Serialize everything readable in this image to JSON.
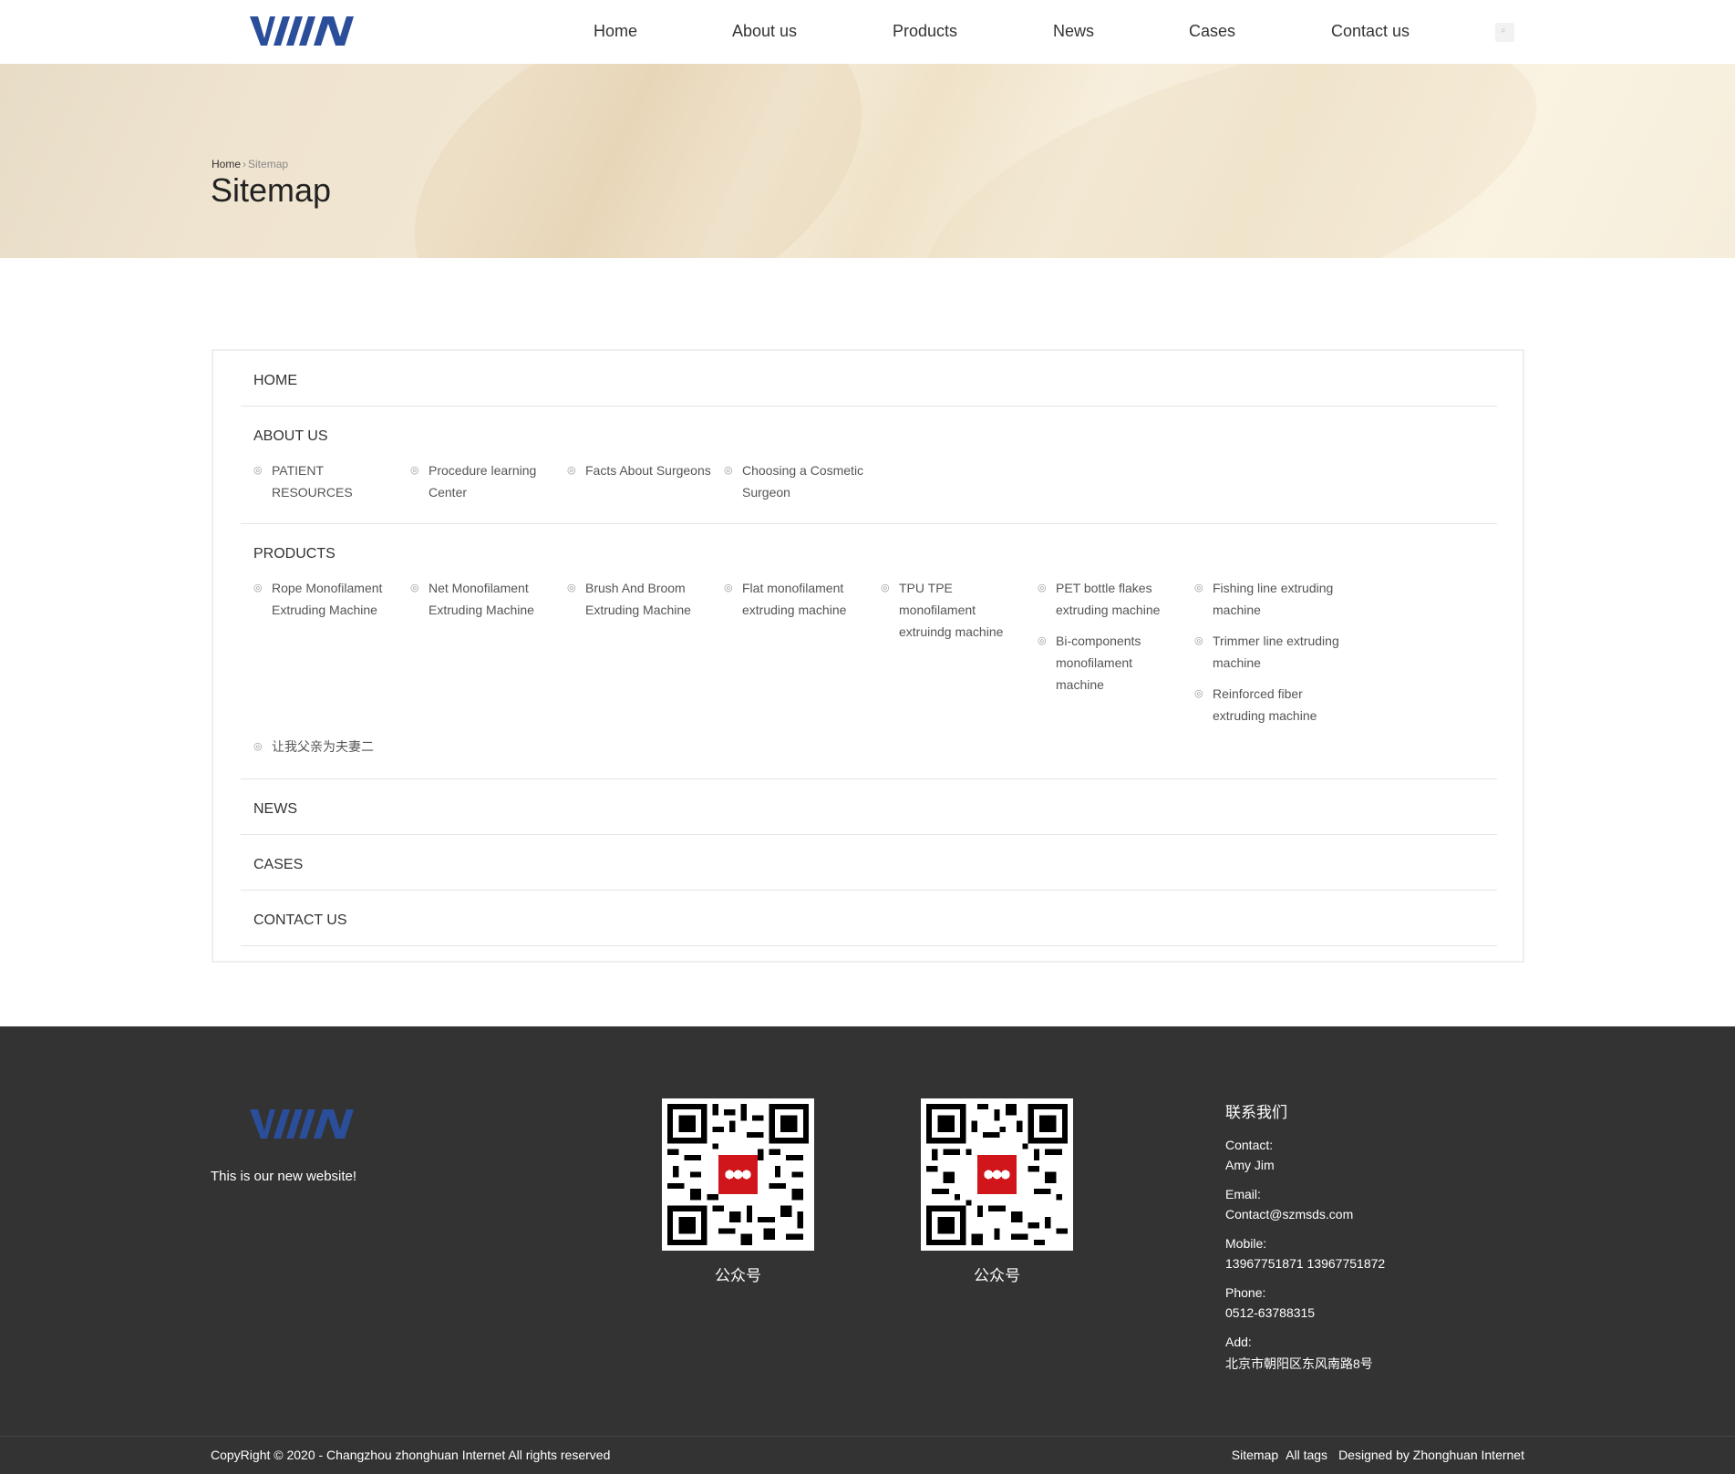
{
  "brand": {
    "logo_text": "VWMA",
    "logo_color": "#2b4e9b"
  },
  "nav": {
    "items": [
      {
        "label": "Home"
      },
      {
        "label": "About us"
      },
      {
        "label": "Products"
      },
      {
        "label": "News"
      },
      {
        "label": "Cases"
      },
      {
        "label": "Contact us"
      }
    ],
    "search_icon": "search-icon"
  },
  "banner": {
    "breadcrumb": {
      "home": "Home",
      "separator": "›",
      "current": "Sitemap"
    },
    "title": "Sitemap"
  },
  "sitemap": {
    "home": "HOME",
    "about": {
      "title": "ABOUT US",
      "items": [
        "PATIENT RESOURCES",
        "Procedure learning Center",
        "Facts About Surgeons",
        "Choosing a Cosmetic Surgeon"
      ]
    },
    "products": {
      "title": "PRODUCTS",
      "items": [
        "Rope Monofilament Extruding Machine",
        "Net Monofilament Extruding Machine",
        "Brush And Broom Extruding Machine",
        "Flat monofilament extruding machine",
        "TPU TPE monofilament extruindg machine",
        "PET bottle flakes extruding machine",
        "Bi-components monofilament machine",
        "Fishing line extruding machine",
        "Trimmer line extruding machine",
        "Reinforced fiber extruding machine",
        "让我父亲为夫妻二"
      ]
    },
    "news": "NEWS",
    "cases": "CASES",
    "contact": "CONTACT US"
  },
  "footer": {
    "tagline": "This is our new website!",
    "qr": [
      {
        "label": "公众号"
      },
      {
        "label": "公众号"
      }
    ],
    "contact_title": "联系我们",
    "contact_label": "Contact:",
    "contact_value": "Amy  Jim",
    "email_label": "Email:",
    "email_value": "Contact@szmsds.com",
    "mobile_label": "Mobile:",
    "mobile_value": "13967751871  13967751872",
    "phone_label": "Phone:",
    "phone_value": "0512-63788315",
    "add_label": "Add:",
    "add_value": "北京市朝阳区东风南路8号",
    "copyright": "CopyRight © 2020 -   Changzhou zhonghuan Internet  All rights reserved",
    "links": [
      "Sitemap",
      "All tags",
      "Designed by Zhonghuan Internet"
    ],
    "bg_color": "#333333"
  }
}
